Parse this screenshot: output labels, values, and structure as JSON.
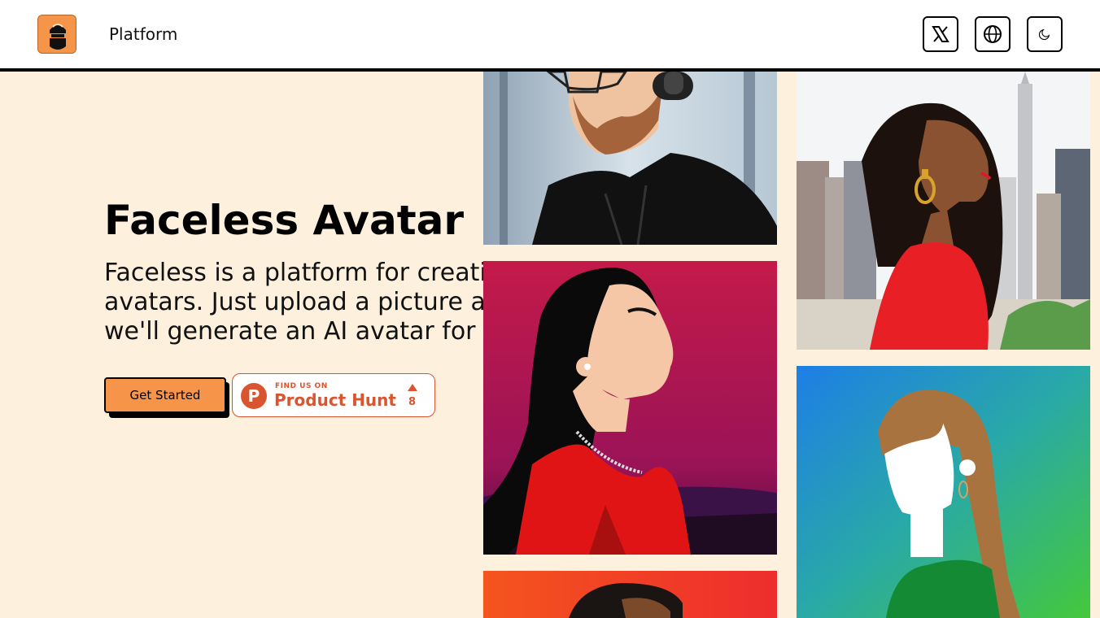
{
  "header": {
    "brand": "Platform",
    "logo_icon": "masked-face-logo",
    "actions": [
      {
        "name": "x-twitter-icon",
        "label": "X"
      },
      {
        "name": "globe-icon",
        "label": "Language"
      },
      {
        "name": "moon-icon",
        "label": "Theme"
      }
    ]
  },
  "hero": {
    "title": "Faceless Avatar",
    "description": "Faceless is a platform for creati\navatars. Just upload a picture a\nwe'll generate an AI avatar for ",
    "cta_label": "Get Started",
    "product_hunt": {
      "small": "FIND US ON",
      "big": "Product Hunt",
      "count": "8"
    }
  },
  "gallery": [
    {
      "name": "avatar-man-headphones-hoodie"
    },
    {
      "name": "avatar-woman-red-dress-profile"
    },
    {
      "name": "avatar-orange-background-partial"
    },
    {
      "name": "avatar-woman-city-skyline"
    },
    {
      "name": "avatar-woman-green-top-blue-background"
    }
  ],
  "colors": {
    "background": "#fdf1de",
    "accent": "#f6954a",
    "producthunt": "#da552f",
    "header_bg": "#ffffff",
    "border": "#000000"
  }
}
